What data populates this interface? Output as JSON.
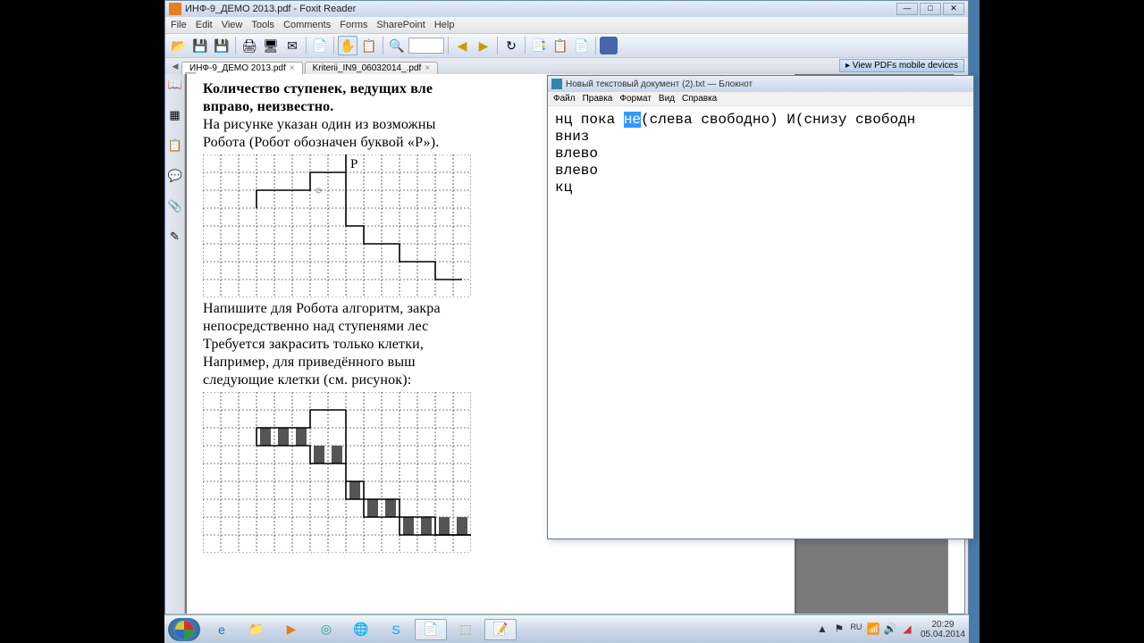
{
  "foxit": {
    "title": "ИНФ-9_ДЕМО 2013.pdf - Foxit Reader",
    "menu": [
      "File",
      "Edit",
      "View",
      "Tools",
      "Comments",
      "Forms",
      "SharePoint",
      "Help"
    ],
    "tabs": {
      "t1": "ИНФ-9_ДЕМО 2013.pdf",
      "t2": "Kriterii_IN9_06032014_.pdf"
    },
    "promo": "View PDFs mobile devices"
  },
  "doc": {
    "l1": "Количество ступенек, ведущих вле",
    "l2": "вправо, неизвестно.",
    "l3": "На рисунке указан один из возможны",
    "l4": "Робота (Робот обозначен буквой «Р»).",
    "marker": "Р",
    "l5": "Напишите для Робота алгоритм, закра",
    "l6": "непосредственно над ступенями лес",
    "l7": "Требуется закрасить только клетки,",
    "l8": "Например, для приведённого выш",
    "l9": "следующие клетки (см. рисунок):"
  },
  "notepad": {
    "title": "Новый текстовый документ (2).txt — Блокнот",
    "menu": [
      "Файл",
      "Правка",
      "Формат",
      "Вид",
      "Справка"
    ],
    "code": {
      "pre1": "нц пока ",
      "sel": "не",
      "post1": "(слева свободно) И(снизу свободн",
      "l2": "вниз",
      "l3": "влево",
      "l4": "влево",
      "l5": "кц"
    }
  },
  "tray": {
    "lang": "RU",
    "time": "20:29",
    "date": "05.04.2014"
  }
}
